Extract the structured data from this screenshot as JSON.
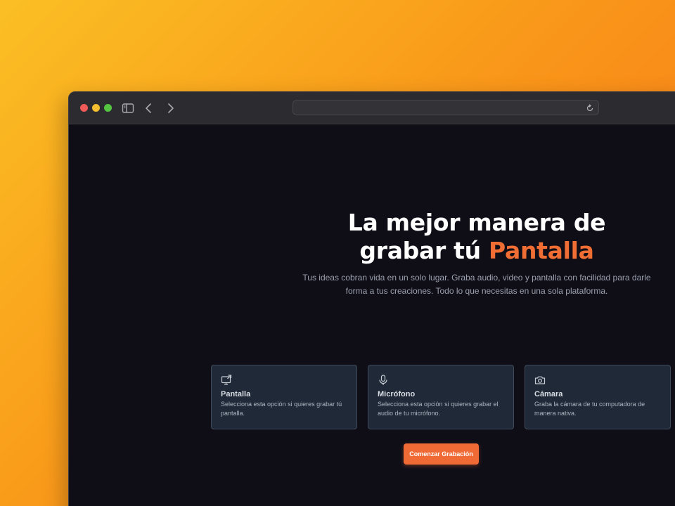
{
  "browser": {
    "address": ""
  },
  "hero": {
    "title_line1": "La mejor manera de",
    "title_line2_prefix": "grabar tú ",
    "title_accent": "Pantalla",
    "subtitle_line1": "Tus ideas cobran vida en un solo lugar. Graba audio, video y pantalla con facilidad para darle",
    "subtitle_line2": "forma a tus creaciones. Todo lo que necesitas en una sola plataforma."
  },
  "options": [
    {
      "icon": "screen-share-icon",
      "title": "Pantalla",
      "description": "Selecciona esta opción si quieres grabar tú pantalla."
    },
    {
      "icon": "microphone-icon",
      "title": "Micrófono",
      "description": "Selecciona esta opción si quieres grabar el audio de tu micrófono."
    },
    {
      "icon": "camera-icon",
      "title": "Cámara",
      "description": "Graba la cámara de tu computadora de manera nativa."
    }
  ],
  "actions": {
    "start_label": "Comenzar Grabación"
  },
  "colors": {
    "accent": "#f06e33",
    "background": "#0f0e17",
    "card": "#1f2937"
  }
}
